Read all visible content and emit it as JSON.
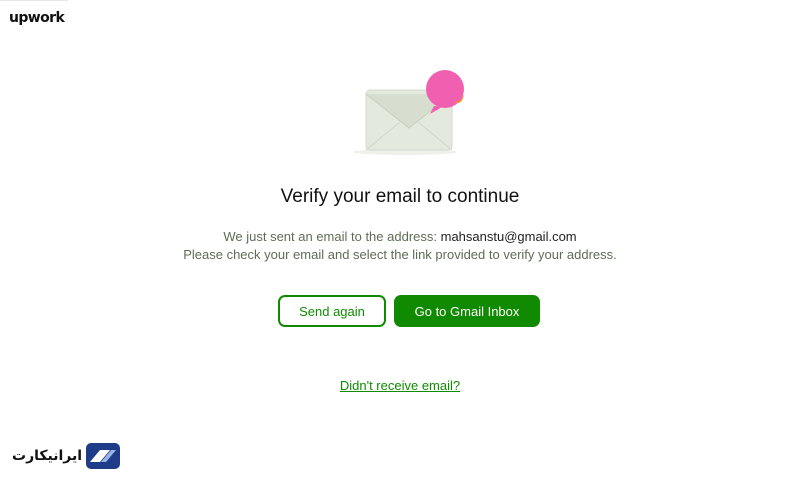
{
  "brand": {
    "logo_text": "upwork"
  },
  "page": {
    "title": "Verify your email to continue",
    "message_prefix": "We just sent an email to the address: ",
    "email": "mahsanstu@gmail.com",
    "message_line2": "Please check your email and select the link provided to verify your address."
  },
  "actions": {
    "send_again": "Send again",
    "go_to_inbox": "Go to Gmail Inbox",
    "didnt_receive": "Didn't receive email?"
  },
  "watermark": {
    "text": "ایرانیکارت"
  },
  "colors": {
    "accent": "#108a00",
    "envelope": "#e4e9dd",
    "bubble": "#f15fb0"
  },
  "icons": {
    "envelope": "envelope-icon",
    "notification": "notification-bubble-icon"
  }
}
